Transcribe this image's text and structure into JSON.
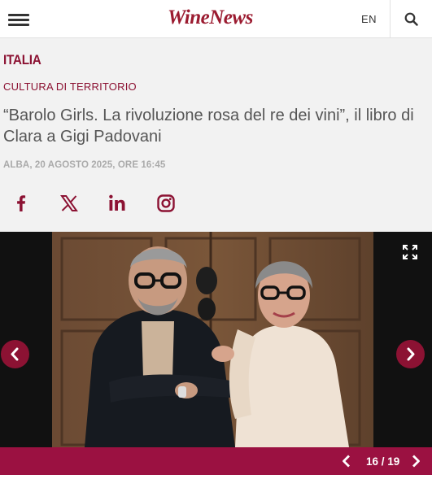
{
  "header": {
    "logo": "WineNews",
    "lang": "EN"
  },
  "article": {
    "category": "ITALIA",
    "section": "CULTURA DI TERRITORIO",
    "title": "“Barolo Girls. La rivoluzione rosa del re dei vini”, il libro di Clara a Gigi Padovani",
    "dateline": "ALBA, 20 AGOSTO 2025, ORE 16:45"
  },
  "social": [
    "facebook-icon",
    "x-icon",
    "linkedin-icon",
    "instagram-icon"
  ],
  "gallery": {
    "counter": "16 / 19",
    "current": 16,
    "total": 19
  },
  "colors": {
    "brand": "#9b1b30",
    "accent": "#8c1233",
    "bar": "#9b1141"
  }
}
